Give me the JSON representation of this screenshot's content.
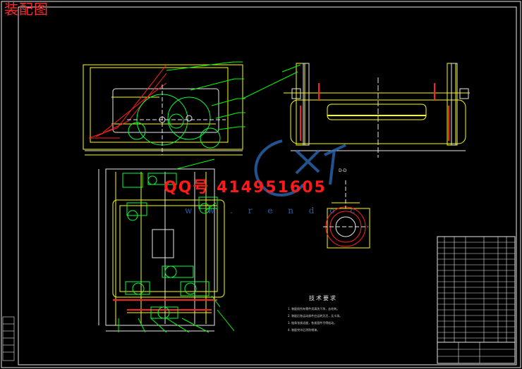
{
  "title_label": "装配图",
  "watermark": {
    "qq": "QQ号  414951605",
    "site": "w w . r e n d o c"
  },
  "section_label": "D-D",
  "tech": {
    "title": "技术要求",
    "lines": [
      "1. 装配前所有零件须清洗干净，去毛刺。",
      "2. 装配后各运动部件应运转灵活，无卡滞。",
      "3. 链条张紧适度，各紧固件不得松动。",
      "4. 装配完毕后涂防锈漆。"
    ]
  },
  "colors": {
    "background": "#000000",
    "outline": "#e8e8e8",
    "part": "#ffff00",
    "gear": "#00ff3a",
    "leader": "#00ff00",
    "accent": "#ff2020",
    "watermark": "#2e6fbf"
  }
}
